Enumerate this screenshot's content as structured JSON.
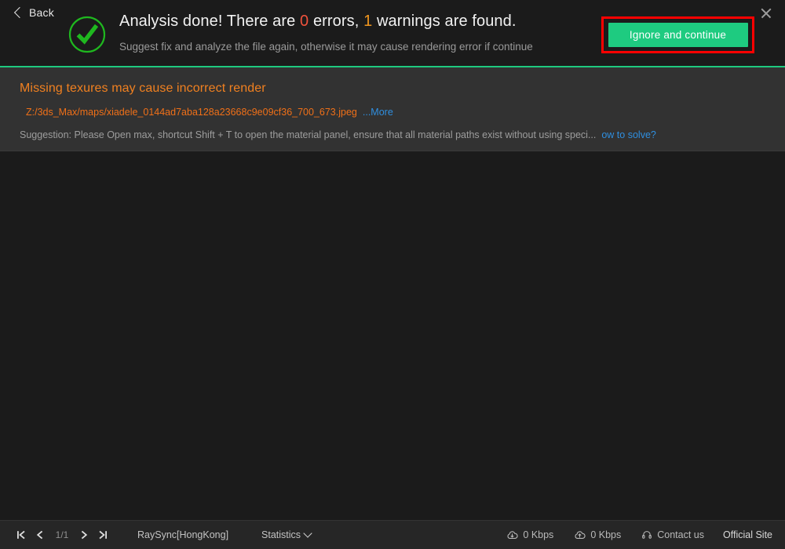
{
  "header": {
    "back_label": "Back",
    "status_icon": "check-circle-icon",
    "title_prefix": "Analysis done! There are ",
    "error_count": "0",
    "title_mid": " errors, ",
    "warning_count": "1",
    "title_suffix": " warnings are found.",
    "subtitle": "Suggest fix and analyze the file again, otherwise it may cause rendering error if continue",
    "ignore_button_label": "Ignore and continue",
    "close_icon": "close-icon",
    "accent_success": "#1ecb80",
    "accent_error": "#f0523c",
    "accent_warning": "#f0961e",
    "highlight_box_color": "#ff0000"
  },
  "warning": {
    "title": "Missing texures may cause incorrect render",
    "path": "Z:/3ds_Max/maps/xiadele_0144ad7aba128a23668c9e09cf36_700_673.jpeg",
    "more_link": "...More",
    "suggestion_label": "Suggestion:",
    "suggestion_text": "Please Open max, shortcut Shift + T to open the material panel, ensure that all material paths exist without using speci...",
    "solve_link": "ow to solve?",
    "title_color": "#f08020",
    "path_color": "#f07018",
    "link_color": "#2f8fe0",
    "panel_bg": "#323232"
  },
  "footer": {
    "pager": {
      "first_icon": "first-page-icon",
      "prev_icon": "prev-page-icon",
      "count": "1/1",
      "next_icon": "next-page-icon",
      "last_icon": "last-page-icon"
    },
    "node_label": "RaySync[HongKong]",
    "statistics_label": "Statistics",
    "statistics_icon": "chevron-down-icon",
    "download_icon": "cloud-download-icon",
    "download_speed": "0 Kbps",
    "upload_icon": "cloud-upload-icon",
    "upload_speed": "0 Kbps",
    "contact_icon": "headset-icon",
    "contact_label": "Contact us",
    "official_site_label": "Official Site"
  }
}
